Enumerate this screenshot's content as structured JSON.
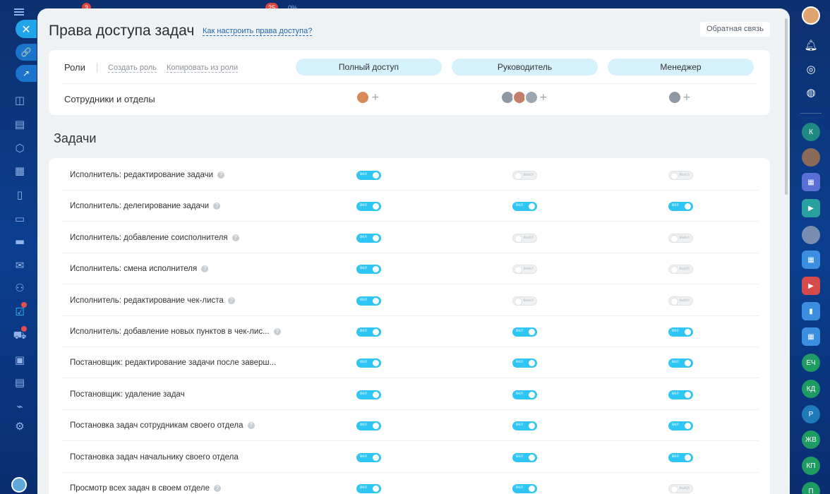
{
  "top_badges": [
    "3",
    "25",
    "0%"
  ],
  "panel": {
    "title": "Права доступа задач",
    "help_link": "Как настроить права доступа?",
    "feedback_button": "Обратная связь"
  },
  "roles": {
    "label": "Роли",
    "create_role": "Создать роль",
    "copy_role": "Копировать из роли",
    "columns": [
      "Полный доступ",
      "Руководитель",
      "Менеджер"
    ],
    "employees_label": "Сотрудники и отделы"
  },
  "section_title": "Задачи",
  "toggle_text": {
    "on": "вкл",
    "off": "выкл"
  },
  "permissions": [
    {
      "label": "Исполнитель: редактирование задачи",
      "help": true,
      "values": [
        true,
        false,
        false
      ]
    },
    {
      "label": "Исполнитель: делегирование задачи",
      "help": true,
      "values": [
        true,
        true,
        true
      ]
    },
    {
      "label": "Исполнитель: добавление соисполнителя",
      "help": true,
      "values": [
        true,
        false,
        false
      ]
    },
    {
      "label": "Исполнитель: смена исполнителя",
      "help": true,
      "values": [
        true,
        false,
        false
      ]
    },
    {
      "label": "Исполнитель: редактирование чек-листа",
      "help": true,
      "values": [
        true,
        false,
        false
      ]
    },
    {
      "label": "Исполнитель: добавление новых пунктов в чек-лис...",
      "help": true,
      "values": [
        true,
        true,
        true
      ]
    },
    {
      "label": "Постановщик: редактирование задачи после заверш...",
      "help": false,
      "values": [
        true,
        true,
        true
      ]
    },
    {
      "label": "Постановщик: удаление задач",
      "help": false,
      "values": [
        true,
        true,
        true
      ]
    },
    {
      "label": "Постановка задач сотрудникам своего отдела",
      "help": true,
      "values": [
        true,
        true,
        true
      ]
    },
    {
      "label": "Постановка задач начальнику своего отдела",
      "help": false,
      "values": [
        true,
        true,
        true
      ]
    },
    {
      "label": "Просмотр всех задач в своем отделе",
      "help": true,
      "values": [
        true,
        true,
        false
      ]
    }
  ],
  "right_sidebar": [
    "К",
    "ЕЧ",
    "КД",
    "Р",
    "ЖВ",
    "КП",
    "П"
  ],
  "colors": {
    "accent": "#2fc6f6",
    "pill": "#d5f1fb",
    "link": "#2067b0"
  }
}
